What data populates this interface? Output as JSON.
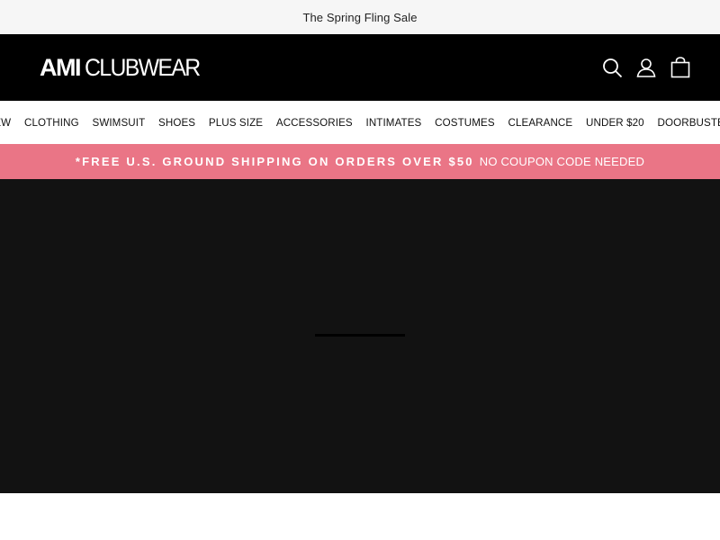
{
  "announcement": {
    "text": "The Spring Fling Sale"
  },
  "header": {
    "logo": {
      "bold": "AMI",
      "light": "CLUBWEAR"
    },
    "icons": [
      "search-icon",
      "account-icon",
      "cart-icon"
    ],
    "colors": {
      "background": "#000000",
      "text": "#ffffff"
    }
  },
  "nav": {
    "items": [
      {
        "label": "NEW"
      },
      {
        "label": "CLOTHING"
      },
      {
        "label": "SWIMSUIT"
      },
      {
        "label": "SHOES"
      },
      {
        "label": "PLUS SIZE"
      },
      {
        "label": "ACCESSORIES"
      },
      {
        "label": "INTIMATES"
      },
      {
        "label": "COSTUMES"
      },
      {
        "label": "CLEARANCE"
      },
      {
        "label": "UNDER $20"
      },
      {
        "label": "DOORBUSTERS"
      }
    ]
  },
  "promo": {
    "strong": "*FREE U.S. GROUND SHIPPING ON ORDERS OVER $50",
    "rest": "NO COUPON CODE NEEDED",
    "color": "#ea7586"
  },
  "hero": {
    "background": "#121212"
  }
}
